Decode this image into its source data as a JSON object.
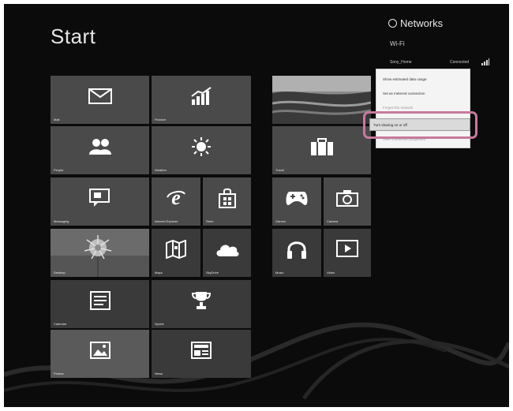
{
  "start": {
    "title": "Start"
  },
  "tiles": {
    "mail": "Mail",
    "finance": "Finance",
    "people": "People",
    "weather": "Weather",
    "messaging": "Messaging",
    "internet_explorer": "Internet Explorer",
    "store": "Store",
    "desktop": "Desktop",
    "maps": "Maps",
    "skydrive": "SkyDrive",
    "calendar": "Calendar",
    "sports": "Sports",
    "photos": "Photos",
    "news": "News",
    "travel": "Travel",
    "games": "Games",
    "camera": "Camera",
    "music": "Music",
    "video": "Video"
  },
  "networks": {
    "title": "Networks",
    "wifi_label": "Wi-Fi",
    "network_name": "Sony_Home",
    "status": "Connected"
  },
  "context_menu": {
    "items": [
      "Show estimated data usage",
      "Set as metered connection",
      "Forget this network",
      "Turn sharing on or off",
      "View connection properties"
    ]
  },
  "colors": {
    "background": "#0b0b0b",
    "tile": "#4a4a4a",
    "highlight": "#c67a9c"
  }
}
